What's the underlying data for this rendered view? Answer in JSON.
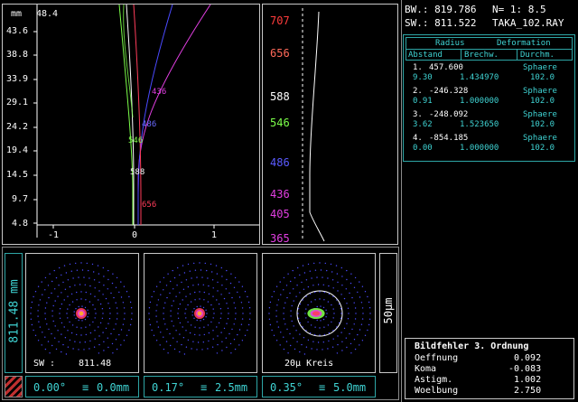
{
  "header": {
    "bw": "BW.: 819.786",
    "n": "N= 1: 8.5",
    "sw": "SW.: 811.522",
    "file": "TAKA_102.RAY"
  },
  "lens_table": {
    "head1": [
      "Radius",
      "Deformation"
    ],
    "head2": [
      "Abstand",
      "Brechw.",
      "Durchm."
    ],
    "rows": [
      {
        "index": "1.",
        "radius": "457.600",
        "deform": "Sphaere",
        "abstand": "9.30",
        "brechw": "1.434970",
        "durchm": "102.0"
      },
      {
        "index": "2.",
        "radius": "-246.328",
        "deform": "Sphaere",
        "abstand": "0.91",
        "brechw": "1.000000",
        "durchm": "102.0"
      },
      {
        "index": "3.",
        "radius": "-248.092",
        "deform": "Sphaere",
        "abstand": "3.62",
        "brechw": "1.523650",
        "durchm": "102.0"
      },
      {
        "index": "4.",
        "radius": "-854.185",
        "deform": "Sphaere",
        "abstand": "0.00",
        "brechw": "1.000000",
        "durchm": "102.0"
      }
    ]
  },
  "aberrations": {
    "title": "Bildfehler 3. Ordnung",
    "items": [
      {
        "label": "Oeffnung",
        "value": "0.092"
      },
      {
        "label": "Koma",
        "value": "-0.083"
      },
      {
        "label": "Astigm.",
        "value": "1.002"
      },
      {
        "label": "Woelbung",
        "value": "2.750"
      }
    ]
  },
  "plot": {
    "unit": "mm",
    "top_value": "48.4",
    "y_ticks": [
      "43.6",
      "38.8",
      "33.9",
      "29.1",
      "24.2",
      "19.4",
      "14.5",
      "9.7",
      "4.8"
    ],
    "x_ticks": [
      "-1",
      "0",
      "1"
    ],
    "curves": [
      {
        "label": "436",
        "color": "#e23fe2"
      },
      {
        "label": "486",
        "color": "#4a4aff"
      },
      {
        "label": "546",
        "color": "#7cff4a"
      },
      {
        "label": "588",
        "color": "#ffffff"
      },
      {
        "label": "656",
        "color": "#ff3c5a"
      }
    ]
  },
  "wavelengths": [
    {
      "label": "707",
      "color": "#ff3c3c"
    },
    {
      "label": "656",
      "color": "#ff5a5a"
    },
    {
      "label": "588",
      "color": "#ffffff"
    },
    {
      "label": "546",
      "color": "#7cff4a"
    },
    {
      "label": "486",
      "color": "#5a5aff"
    },
    {
      "label": "436",
      "color": "#e23fe2"
    },
    {
      "label": "405",
      "color": "#e23fe2"
    },
    {
      "label": "365",
      "color": "#e23fe2"
    }
  ],
  "spots": {
    "side_label": "811.48 mm",
    "scale_label": "50µm",
    "sw_label": "SW :",
    "sw_value": "811.48",
    "circle_label": "20µ Kreis",
    "fields": [
      {
        "angle": "0.00°",
        "equiv": "≡",
        "height": "0.0mm"
      },
      {
        "angle": "0.17°",
        "equiv": "≡",
        "height": "2.5mm"
      },
      {
        "angle": "0.35°",
        "equiv": "≡",
        "height": "5.0mm"
      }
    ]
  }
}
